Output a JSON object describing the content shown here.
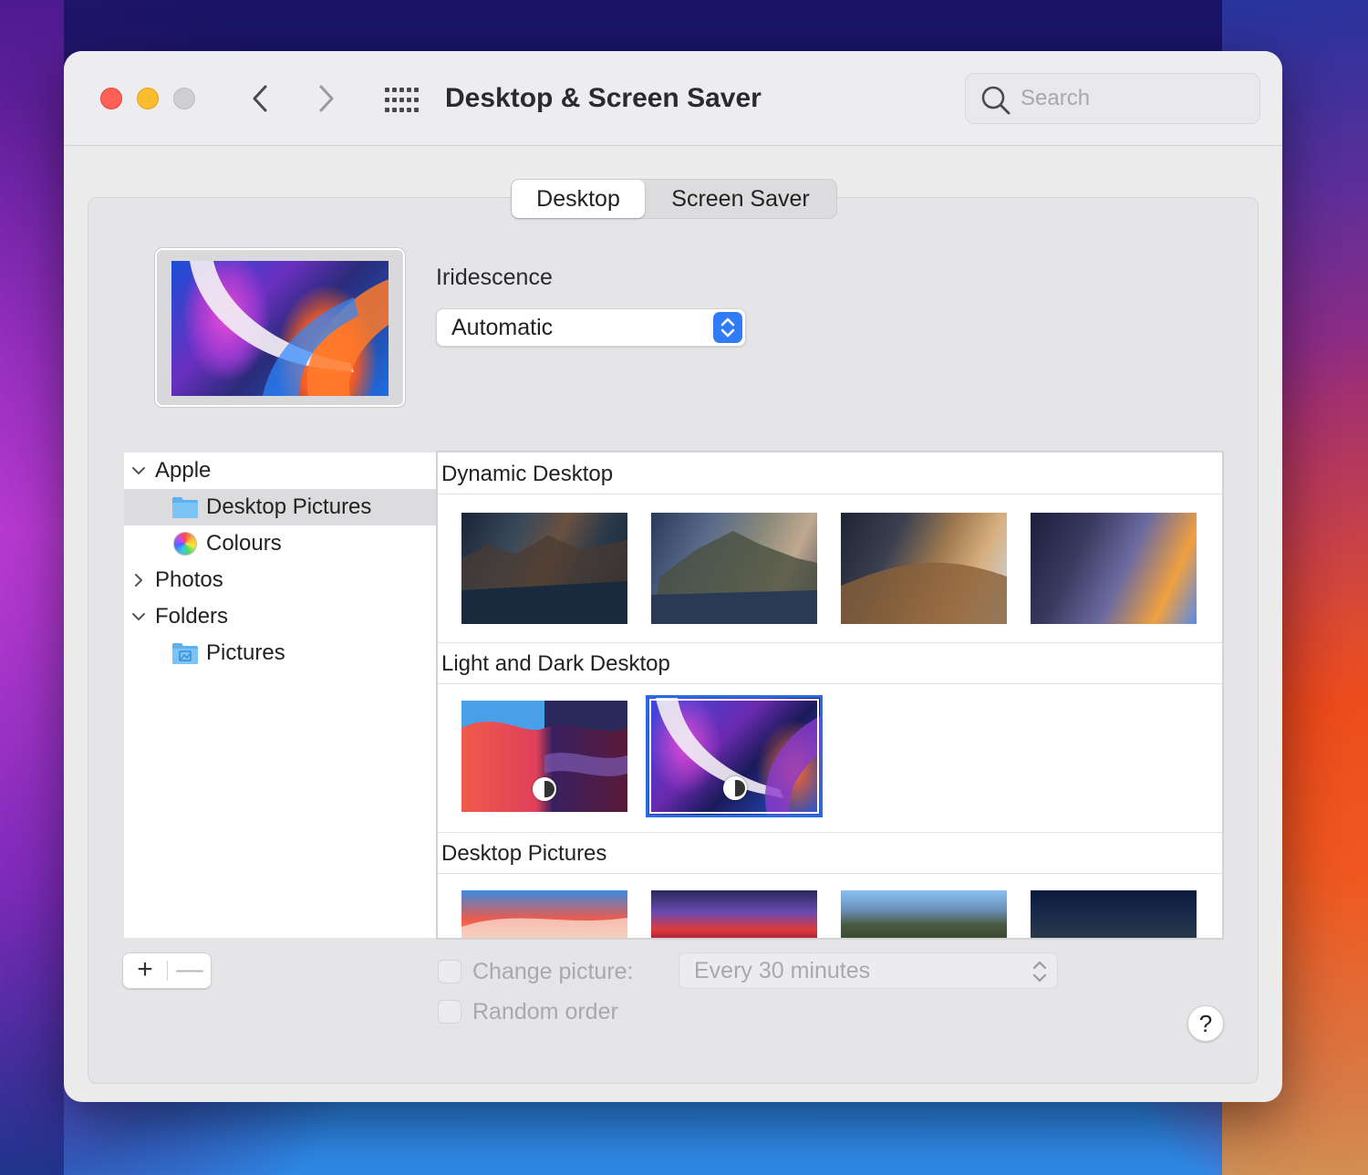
{
  "window": {
    "title": "Desktop & Screen Saver",
    "search_placeholder": "Search"
  },
  "tabs": [
    {
      "label": "Desktop",
      "selected": true
    },
    {
      "label": "Screen Saver",
      "selected": false
    }
  ],
  "current_wallpaper": {
    "name": "Iridescence",
    "appearance": "Automatic"
  },
  "sidebar": {
    "items": [
      {
        "label": "Apple",
        "expanded": true,
        "icon": "chevron-down-icon"
      },
      {
        "label": "Desktop Pictures",
        "selected": true,
        "icon": "folder-icon"
      },
      {
        "label": "Colours",
        "icon": "color-wheel-icon"
      },
      {
        "label": "Photos",
        "expanded": false,
        "icon": "chevron-right-icon"
      },
      {
        "label": "Folders",
        "expanded": true,
        "icon": "chevron-down-icon"
      },
      {
        "label": "Pictures",
        "icon": "pictures-folder-icon"
      }
    ]
  },
  "sections": [
    {
      "title": "Dynamic Desktop",
      "thumbnails": [
        "catalina-dynamic",
        "catalina-island-dynamic",
        "mojave-dynamic",
        "solar-gradients-dynamic"
      ]
    },
    {
      "title": "Light and Dark Desktop",
      "thumbnails": [
        "big-sur-light-dark",
        "iridescence-light-dark"
      ]
    },
    {
      "title": "Desktop Pictures",
      "thumbnails": [
        "big-sur-graphic",
        "big-sur-red",
        "big-sur-coastline",
        "big-sur-night"
      ]
    }
  ],
  "selected_thumbnail": "iridescence-light-dark",
  "footer": {
    "add_label": "+",
    "remove_label": "—",
    "change_picture_label": "Change picture:",
    "change_picture_checked": false,
    "interval_value": "Every 30 minutes",
    "random_order_label": "Random order",
    "random_order_checked": false,
    "help_label": "?"
  },
  "colors": {
    "accent": "#2f7cf6",
    "selection_border": "#2a6be0",
    "close": "#ff5f57",
    "minimize": "#febc2e"
  }
}
